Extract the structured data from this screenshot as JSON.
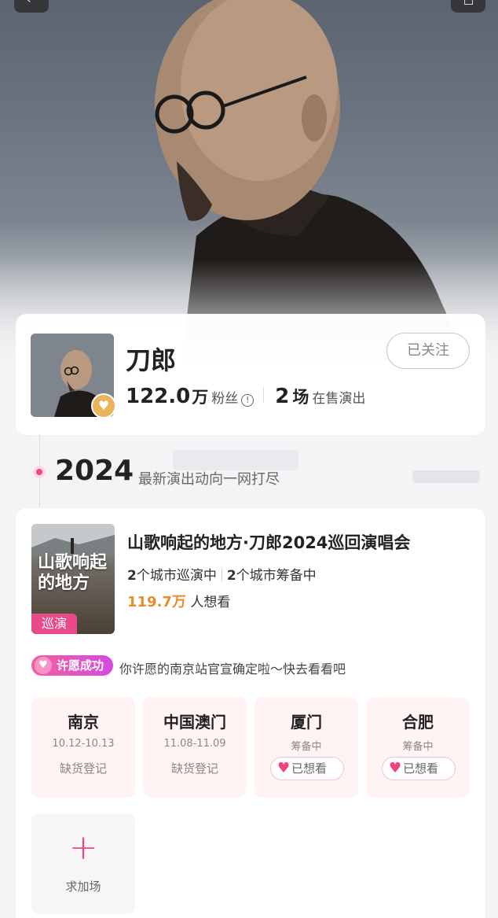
{
  "nav": {
    "back_icon": "back-arrow-icon",
    "share_icon": "share-icon"
  },
  "artist": {
    "name": "刀郎",
    "follow_label": "已关注",
    "fans_num": "122.0",
    "fans_unit": "万",
    "fans_label": "粉丝",
    "shows_num": "2",
    "shows_unit": "场",
    "shows_label": "在售演出"
  },
  "timeline": {
    "year": "2024",
    "subtitle": "最新演出动向一网打尽"
  },
  "event": {
    "poster_text": "山歌响起的地方",
    "poster_tag": "巡演",
    "title": "山歌响起的地方·刀郎2024巡回演唱会",
    "touring_num": "2",
    "touring_label": "个城市巡演中",
    "prep_num": "2",
    "prep_label": "个城市筹备中",
    "want_num": "119.7万",
    "want_label": "人想看"
  },
  "wish": {
    "badge": "许愿成功",
    "text": "你许愿的南京站官宣确定啦～快去看看吧"
  },
  "cities": [
    {
      "name": "南京",
      "date": "10.12-10.13",
      "status": "缺货登记"
    },
    {
      "name": "中国澳门",
      "date": "11.08-11.09",
      "status": "缺货登记"
    },
    {
      "name": "厦门",
      "date": "筹备中",
      "button": "已想看"
    },
    {
      "name": "合肥",
      "date": "筹备中",
      "button": "已想看"
    }
  ],
  "add_show": {
    "plus": "+",
    "label": "求加场"
  },
  "colors": {
    "accent": "#f0447a",
    "want_orange": "#e88b2a",
    "badge_gold": "#e9b45c"
  }
}
